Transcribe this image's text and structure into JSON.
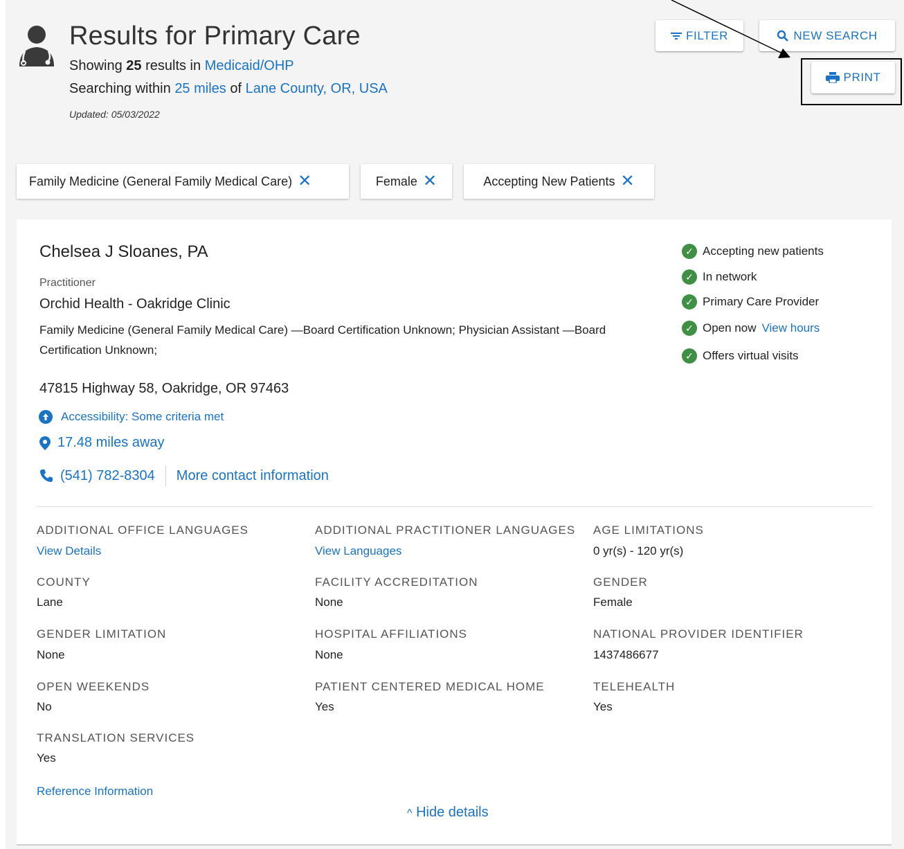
{
  "header": {
    "title": "Results for Primary Care",
    "showing_prefix": "Showing",
    "result_count": "25",
    "results_in": "results in",
    "plan": "Medicaid/OHP",
    "searching_within": "Searching within",
    "radius": "25 miles",
    "of": "of",
    "location": "Lane County, OR, USA",
    "updated": "Updated: 05/03/2022",
    "icon": "doctor-avatar-icon"
  },
  "toolbar": {
    "filter_label": "FILTER",
    "new_search_label": "NEW SEARCH",
    "print_label": "PRINT",
    "accent_color": "#1a73c4"
  },
  "chips": [
    {
      "label": "Family Medicine (General Family Medical Care)"
    },
    {
      "label": "Female"
    },
    {
      "label": "Accepting New Patients"
    }
  ],
  "provider": {
    "name": "Chelsea J Sloanes, PA",
    "type": "Practitioner",
    "clinic": "Orchid Health - Oakridge Clinic",
    "specialty": "Family Medicine (General Family Medical Care) —Board Certification Unknown; Physician Assistant —Board Certification Unknown;",
    "address": "47815 Highway 58, Oakridge, OR 97463",
    "accessibility": "Accessibility: Some criteria met",
    "distance": "17.48 miles away",
    "phone": "(541) 782-8304",
    "more_contact": "More contact information",
    "status": {
      "accepting": "Accepting new patients",
      "network": "In network",
      "pcp": "Primary Care Provider",
      "open_now": "Open now",
      "view_hours": "View hours",
      "virtual": "Offers virtual visits",
      "check_color": "#3f8f45"
    }
  },
  "details": {
    "office_languages_label": "ADDITIONAL OFFICE LANGUAGES",
    "office_languages_value": "View Details",
    "practitioner_languages_label": "ADDITIONAL PRACTITIONER LANGUAGES",
    "practitioner_languages_value": "View Languages",
    "age_label": "AGE LIMITATIONS",
    "age_value": "0 yr(s) - 120 yr(s)",
    "county_label": "COUNTY",
    "county_value": "Lane",
    "accreditation_label": "FACILITY ACCREDITATION",
    "accreditation_value": "None",
    "gender_label": "GENDER",
    "gender_value": "Female",
    "gender_limitation_label": "GENDER LIMITATION",
    "gender_limitation_value": "None",
    "hospital_label": "HOSPITAL AFFILIATIONS",
    "hospital_value": "None",
    "npi_label": "NATIONAL PROVIDER IDENTIFIER",
    "npi_value": "1437486677",
    "weekends_label": "OPEN WEEKENDS",
    "weekends_value": "No",
    "pcmh_label": "PATIENT CENTERED MEDICAL HOME",
    "pcmh_value": "Yes",
    "telehealth_label": "TELEHEALTH",
    "telehealth_value": "Yes",
    "translation_label": "TRANSLATION SERVICES",
    "translation_value": "Yes",
    "reference": "Reference Information",
    "hide_details": "Hide details"
  }
}
